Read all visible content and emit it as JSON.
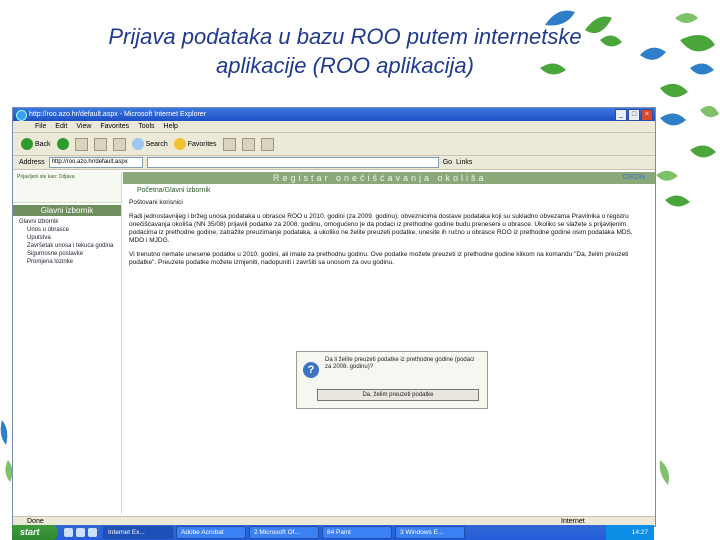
{
  "slide": {
    "title_line1": "Prijava podataka u bazu ROO putem internetske",
    "title_line2": "aplikacije (ROO aplikacija)"
  },
  "browser": {
    "window_title": "http://roo.azo.hr/default.aspx - Microsoft Internet Explorer",
    "menu": [
      "File",
      "Edit",
      "View",
      "Favorites",
      "Tools",
      "Help"
    ],
    "toolbar": {
      "back_label": "Back",
      "search_label": "Search",
      "favorites_label": "Favorites"
    },
    "address_label": "Address",
    "address_value": "http://roo.azo.hr/default.aspx",
    "go_label": "Go",
    "links_label": "Links",
    "status_text": "Done",
    "zone_text": "Internet"
  },
  "app": {
    "banner": "Registar onečišćavanja okoliša",
    "banner_logo": "OIKON",
    "breadcrumb": "Početna/Glavni izbornik",
    "sidebar_title": "Glavni izbornik",
    "sidebar_header_text": "Prijavljeni ste kao: Odjava",
    "tree": [
      {
        "label": "Glavni izbornik",
        "sub": false
      },
      {
        "label": "Unos u obrasce",
        "sub": true
      },
      {
        "label": "Uputstva",
        "sub": true
      },
      {
        "label": "Završetak unosa i tekuća godina",
        "sub": true
      },
      {
        "label": "Sigurnosne postavke",
        "sub": true
      },
      {
        "label": "Promjena lozinke",
        "sub": true
      }
    ],
    "greeting": "Poštovani korisnici",
    "paragraph1": "Radi jednostavnijeg i bržeg unosa podataka u obrasce ROO u 2010. godini (za 2009. godinu), obveznicima dostave podataka koji su sukladno obvezama Pravilnika o registru onečišćavanja okoliša (NN 35/08) prijavili podatke za 2008. godinu, omogućeno je da podaci iz prethodne godine budu preneseni u obrasce. Ukoliko se slažete s prijavljenim podacima iz prethodne godine, zatražite preuzimanje podataka, a ukoliko ne želite preuzeti podatke, unesite ih ručno u obrasce ROO iz prethodne godine osim podataka MDS, MDO i MJDG.",
    "paragraph2": "Vi trenutno nemate unesene podatke u 2010. godini, ali imate za prethodnu godinu. Ove podatke možete preuzeti iz prethodne godine klikom na komandu \"Da, želim preuzeti podatke\". Preuzete podatke možete izmjeniti, nadopuniti i završiti sa unosom za ovu godinu.",
    "dialog": {
      "question": "Da li želite preuzeti podatke iz prethodne godine (podaci za 2008. godinu)?",
      "button_label": "Da, želim preuzeti podatke"
    }
  },
  "taskbar": {
    "start_label": "start",
    "tasks": [
      "Internet Ex...",
      "Adobe Acrobat",
      "2 Microsoft Of...",
      "84 Paint",
      "3 Windows E..."
    ],
    "clock": "14:27"
  },
  "colors": {
    "title_blue": "#1f3a8f",
    "leaf_green": "#4aa63a",
    "leaf_blue": "#2f7fc8",
    "banner_green": "#8aa87a",
    "xp_blue": "#245ddb"
  }
}
